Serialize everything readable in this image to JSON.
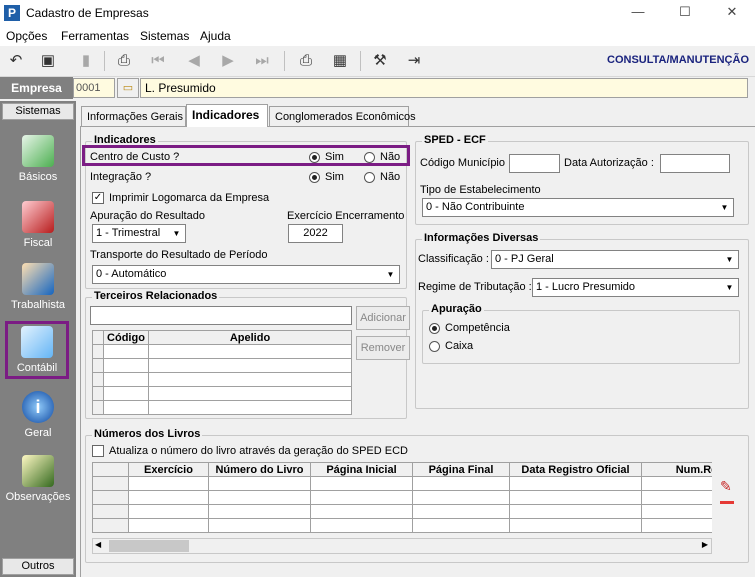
{
  "window": {
    "title": "Cadastro de Empresas",
    "min": "—",
    "max": "☐",
    "close": "✕",
    "app_icon": "P"
  },
  "menu": [
    "Opções",
    "Ferramentas",
    "Sistemas",
    "Ajuda"
  ],
  "toolbar": {
    "mode": "CONSULTA/MANUTENÇÃO"
  },
  "empresa": {
    "label": "Empresa",
    "code": "0001",
    "name": "L. Presumido"
  },
  "sidebar": {
    "header": "Sistemas",
    "footer": "Outros",
    "items": [
      "Básicos",
      "Fiscal",
      "Trabalhista",
      "Contábil",
      "Geral",
      "Observações"
    ]
  },
  "tabs": [
    "Informações Gerais",
    "Indicadores",
    "Conglomerados Econômicos"
  ],
  "indicadores": {
    "legend": "Indicadores",
    "centro_custo": "Centro de Custo ?",
    "integracao": "Integração ?",
    "sim": "Sim",
    "nao": "Não",
    "imprimir_logo": "Imprimir Logomarca da Empresa",
    "apuracao_label": "Apuração do Resultado",
    "apuracao_value": "1 - Trimestral",
    "exercicio_label": "Exercício Encerramento",
    "exercicio_value": "2022",
    "transporte_label": "Transporte do Resultado de Período",
    "transporte_value": "0 - Automático"
  },
  "terceiros": {
    "legend": "Terceiros Relacionados",
    "col_codigo": "Código",
    "col_apelido": "Apelido",
    "adicionar": "Adicionar",
    "remover": "Remover"
  },
  "sped": {
    "legend": "SPED - ECF",
    "cod_municipio": "Código Município :",
    "data_autorizacao": "Data Autorização :",
    "tipo_label": "Tipo de Estabelecimento",
    "tipo_value": "0 - Não Contribuinte"
  },
  "info": {
    "legend": "Informações Diversas",
    "classificacao_label": "Classificação :",
    "classificacao_value": "0 - PJ Geral",
    "regime_label": "Regime de Tributação :",
    "regime_value": "1 - Lucro Presumido"
  },
  "apuracao": {
    "legend": "Apuração",
    "competencia": "Competência",
    "caixa": "Caixa"
  },
  "livros": {
    "legend": "Números dos Livros",
    "atualiza": "Atualiza o número do livro através da geração do SPED ECD",
    "cols": [
      "Exercício",
      "Número do Livro",
      "Página Inicial",
      "Página Final",
      "Data Registro Oficial",
      "Num.Re"
    ]
  }
}
